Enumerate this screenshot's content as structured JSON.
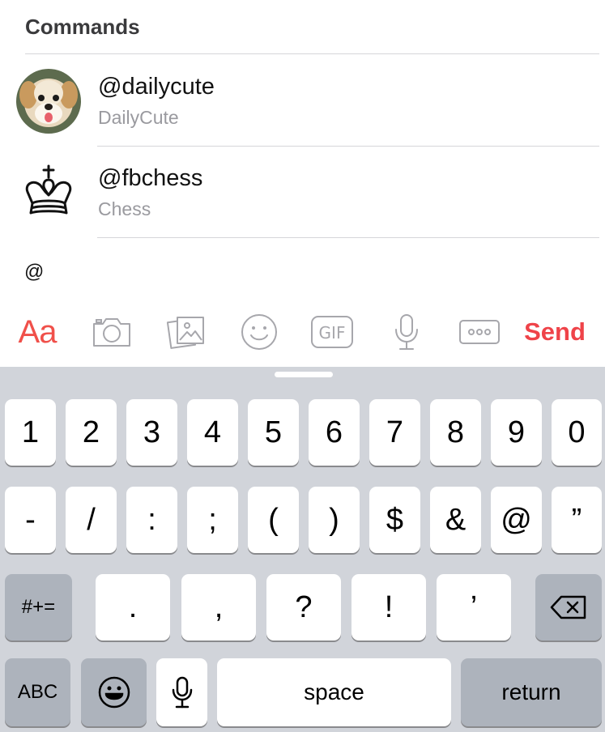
{
  "commands": {
    "header": "Commands",
    "items": [
      {
        "handle": "@dailycute",
        "name": "DailyCute",
        "icon": "puppy-avatar"
      },
      {
        "handle": "@fbchess",
        "name": "Chess",
        "icon": "chess-king-icon"
      }
    ]
  },
  "composer": {
    "text": "@"
  },
  "toolbar": {
    "aa_label": "Aa",
    "gif_label": "GIF",
    "send_label": "Send",
    "accent_color": "#ef4349",
    "icons": [
      "camera-icon",
      "gallery-icon",
      "smiley-icon",
      "gif-icon",
      "microphone-icon",
      "more-icon"
    ]
  },
  "keyboard": {
    "row1": [
      "1",
      "2",
      "3",
      "4",
      "5",
      "6",
      "7",
      "8",
      "9",
      "0"
    ],
    "row2": [
      "-",
      "/",
      ":",
      ";",
      "(",
      ")",
      "$",
      "&",
      "@",
      "”"
    ],
    "row3": [
      ".",
      ",",
      "?",
      "!",
      "’"
    ],
    "shift_label": "#+=",
    "abc_label": "ABC",
    "space_label": "space",
    "return_label": "return"
  }
}
